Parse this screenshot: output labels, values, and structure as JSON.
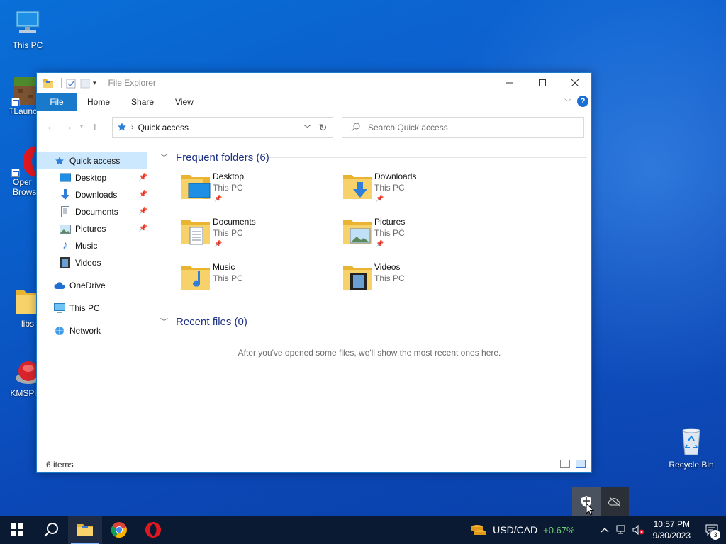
{
  "desktop": {
    "icons": [
      {
        "label": "This PC"
      },
      {
        "label": "TLaunc"
      },
      {
        "label": "Oper Brows"
      },
      {
        "label": "libs"
      },
      {
        "label": "KMSPico"
      },
      {
        "label": "Recycle Bin"
      }
    ]
  },
  "window": {
    "title": "File Explorer",
    "ribbon_tabs": {
      "file": "File",
      "home": "Home",
      "share": "Share",
      "view": "View"
    },
    "help": "?",
    "address": {
      "path": "Quick access"
    },
    "search": {
      "placeholder": "Search Quick access"
    },
    "sidebar": {
      "quick_access": "Quick access",
      "pinned": [
        {
          "label": "Desktop"
        },
        {
          "label": "Downloads"
        },
        {
          "label": "Documents"
        },
        {
          "label": "Pictures"
        },
        {
          "label": "Music"
        },
        {
          "label": "Videos"
        }
      ],
      "onedrive": "OneDrive",
      "this_pc": "This PC",
      "network": "Network"
    },
    "frequent": {
      "header": "Frequent folders (6)",
      "folders": [
        {
          "name": "Desktop",
          "location": "This PC",
          "pinned": true
        },
        {
          "name": "Downloads",
          "location": "This PC",
          "pinned": true
        },
        {
          "name": "Documents",
          "location": "This PC",
          "pinned": true
        },
        {
          "name": "Pictures",
          "location": "This PC",
          "pinned": true
        },
        {
          "name": "Music",
          "location": "This PC",
          "pinned": false
        },
        {
          "name": "Videos",
          "location": "This PC",
          "pinned": false
        }
      ]
    },
    "recent": {
      "header": "Recent files (0)",
      "empty_message": "After you've opened some files, we'll show the most recent ones here."
    },
    "status": {
      "item_count": "6 items"
    }
  },
  "taskbar": {
    "ticker": {
      "pair": "USD/CAD",
      "change": "+0.67%"
    },
    "clock": {
      "time": "10:57 PM",
      "date": "9/30/2023"
    },
    "notifications": {
      "count": "3"
    }
  },
  "colors": {
    "accent": "#1979ca",
    "taskbar": "#0b1a33",
    "folder": "#f5c748"
  }
}
